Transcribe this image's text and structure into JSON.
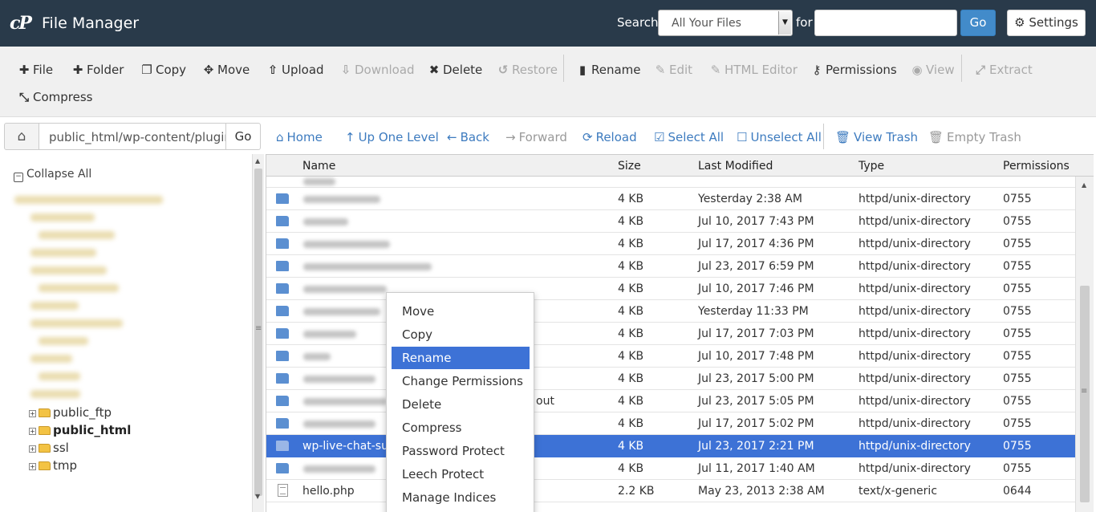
{
  "header": {
    "logo": "cP",
    "title": "File Manager",
    "search_label": "Search",
    "search_scope": "All Your Files",
    "for_label": "for",
    "search_value": "",
    "go_label": "Go",
    "settings_label": "Settings"
  },
  "toolbar": {
    "file": "File",
    "folder": "Folder",
    "copy": "Copy",
    "move": "Move",
    "upload": "Upload",
    "download": "Download",
    "delete": "Delete",
    "restore": "Restore",
    "rename": "Rename",
    "edit": "Edit",
    "html_editor": "HTML Editor",
    "permissions": "Permissions",
    "view": "View",
    "extract": "Extract",
    "compress": "Compress"
  },
  "pathbar": {
    "path": "public_html/wp-content/plugin",
    "go_label": "Go"
  },
  "nav": {
    "home": "Home",
    "up": "Up One Level",
    "back": "Back",
    "forward": "Forward",
    "reload": "Reload",
    "select_all": "Select All",
    "unselect_all": "Unselect All",
    "view_trash": "View Trash",
    "empty_trash": "Empty Trash"
  },
  "tree": {
    "collapse_all": "Collapse All",
    "nodes": [
      "public_ftp",
      "public_html",
      "ssl",
      "tmp"
    ]
  },
  "table": {
    "headers": {
      "name": "Name",
      "size": "Size",
      "modified": "Last Modified",
      "type": "Type",
      "perms": "Permissions"
    },
    "rows": [
      {
        "name": "",
        "size": "4 KB",
        "modified": "Yesterday 2:38 AM",
        "type": "httpd/unix-directory",
        "perms": "0755"
      },
      {
        "name": "",
        "size": "4 KB",
        "modified": "Jul 10, 2017 7:43 PM",
        "type": "httpd/unix-directory",
        "perms": "0755"
      },
      {
        "name": "",
        "size": "4 KB",
        "modified": "Jul 17, 2017 4:36 PM",
        "type": "httpd/unix-directory",
        "perms": "0755"
      },
      {
        "name": "",
        "size": "4 KB",
        "modified": "Jul 23, 2017 6:59 PM",
        "type": "httpd/unix-directory",
        "perms": "0755"
      },
      {
        "name": "",
        "size": "4 KB",
        "modified": "Jul 10, 2017 7:46 PM",
        "type": "httpd/unix-directory",
        "perms": "0755"
      },
      {
        "name": "",
        "size": "4 KB",
        "modified": "Yesterday 11:33 PM",
        "type": "httpd/unix-directory",
        "perms": "0755"
      },
      {
        "name": "",
        "size": "4 KB",
        "modified": "Jul 17, 2017 7:03 PM",
        "type": "httpd/unix-directory",
        "perms": "0755"
      },
      {
        "name": "",
        "size": "4 KB",
        "modified": "Jul 10, 2017 7:48 PM",
        "type": "httpd/unix-directory",
        "perms": "0755"
      },
      {
        "name": "",
        "size": "4 KB",
        "modified": "Jul 23, 2017 5:00 PM",
        "type": "httpd/unix-directory",
        "perms": "0755"
      },
      {
        "name": "out",
        "size": "4 KB",
        "modified": "Jul 23, 2017 5:05 PM",
        "type": "httpd/unix-directory",
        "perms": "0755"
      },
      {
        "name": "",
        "size": "4 KB",
        "modified": "Jul 17, 2017 5:02 PM",
        "type": "httpd/unix-directory",
        "perms": "0755"
      },
      {
        "name": "wp-live-chat-sup",
        "size": "4 KB",
        "modified": "Jul 23, 2017 2:21 PM",
        "type": "httpd/unix-directory",
        "perms": "0755"
      },
      {
        "name": "",
        "size": "4 KB",
        "modified": "Jul 11, 2017 1:40 AM",
        "type": "httpd/unix-directory",
        "perms": "0755"
      },
      {
        "name": "hello.php",
        "size": "2.2 KB",
        "modified": "May 23, 2013 2:38 AM",
        "type": "text/x-generic",
        "perms": "0644"
      }
    ]
  },
  "context_menu": {
    "items": [
      "Move",
      "Copy",
      "Rename",
      "Change Permissions",
      "Delete",
      "Compress",
      "Password Protect",
      "Leech Protect",
      "Manage Indices"
    ],
    "highlighted": "Rename"
  },
  "colors": {
    "header_bg": "#293a4a",
    "selection": "#3d72d6",
    "link": "#3d7bbf",
    "primary_button": "#428bca"
  }
}
